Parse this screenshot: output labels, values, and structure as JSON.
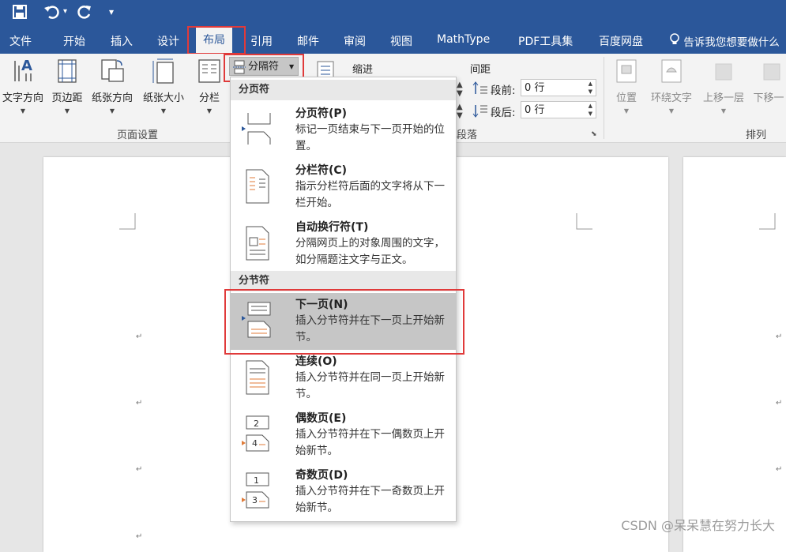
{
  "qat": {
    "icons": [
      "save-icon",
      "undo-icon",
      "redo-icon",
      "customize-icon"
    ]
  },
  "tabs": [
    {
      "label": "文件"
    },
    {
      "label": "开始"
    },
    {
      "label": "插入"
    },
    {
      "label": "设计"
    },
    {
      "label": "布局",
      "active": true
    },
    {
      "label": "引用"
    },
    {
      "label": "邮件"
    },
    {
      "label": "审阅"
    },
    {
      "label": "视图"
    },
    {
      "label": "MathType"
    },
    {
      "label": "PDF工具集"
    },
    {
      "label": "百度网盘"
    }
  ],
  "tell_me": "告诉我您想要做什么",
  "ribbon": {
    "page_setup": {
      "buttons": [
        "文字方向",
        "页边距",
        "纸张方向",
        "纸张大小",
        "分栏"
      ],
      "group_label": "页面设置",
      "breaks_label": "分隔符"
    },
    "paragraph": {
      "indent_label": "缩进",
      "spacing_label": "间距",
      "before_label": "段前:",
      "before_value": "0 行",
      "after_label": "段后:",
      "after_value": "0 行",
      "group_label": "段落"
    },
    "arrange": {
      "buttons": [
        "位置",
        "环绕文字",
        "上移一层",
        "下移一"
      ],
      "group_label": "排列"
    }
  },
  "menu": {
    "page_breaks_header": "分页符",
    "section_breaks_header": "分节符",
    "items": [
      {
        "title": "分页符(P)",
        "desc": "标记一页结束与下一页开始的位置。"
      },
      {
        "title": "分栏符(C)",
        "desc": "指示分栏符后面的文字将从下一栏开始。"
      },
      {
        "title": "自动换行符(T)",
        "desc": "分隔网页上的对象周围的文字，如分隔题注文字与正文。"
      },
      {
        "title": "下一页(N)",
        "desc": "插入分节符并在下一页上开始新节。",
        "highlighted": true
      },
      {
        "title": "连续(O)",
        "desc": "插入分节符并在同一页上开始新节。"
      },
      {
        "title": "偶数页(E)",
        "desc": "插入分节符并在下一偶数页上开始新节。"
      },
      {
        "title": "奇数页(D)",
        "desc": "插入分节符并在下一奇数页上开始新节。"
      }
    ]
  },
  "paragraph_mark": "↵",
  "watermark": "CSDN @呆呆慧在努力长大",
  "colors": {
    "title_bar": "#2b579a",
    "ribbon": "#f3f3f3",
    "highlight": "#c6c6c6",
    "annotation": "#e03a3a",
    "accent": "#e07b39"
  }
}
